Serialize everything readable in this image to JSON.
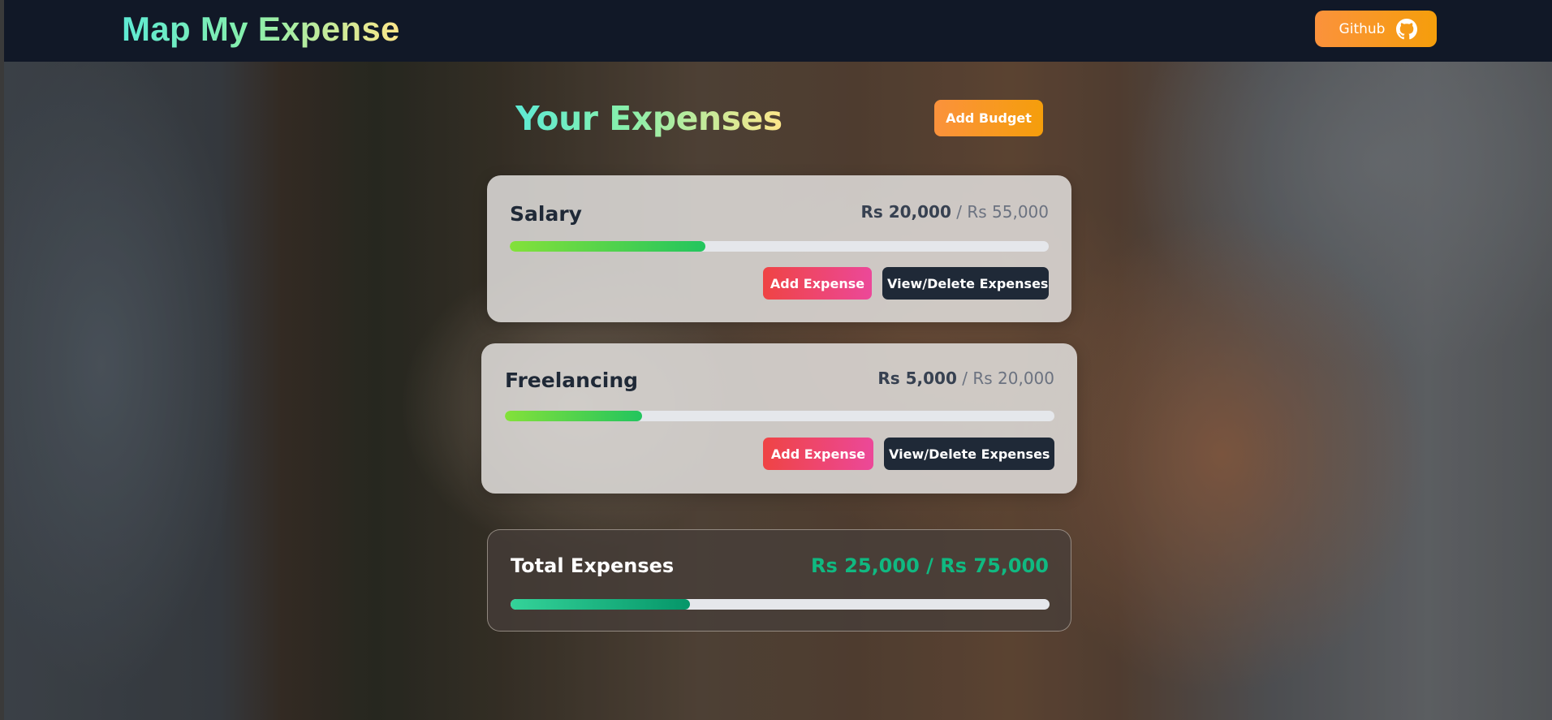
{
  "header": {
    "brand": "Map My Expense",
    "github_label": "Github"
  },
  "main": {
    "title": "Your Expenses",
    "add_budget_label": "Add Budget"
  },
  "budgets": [
    {
      "name": "Salary",
      "spent": "Rs 20,000",
      "max": "/ Rs 55,000",
      "progress": 0.3636,
      "add_expense_label": "Add Expense",
      "view_delete_label": "View/Delete Expenses"
    },
    {
      "name": "Freelancing",
      "spent": "Rs 5,000",
      "max": "/ Rs 20,000",
      "progress": 0.25,
      "add_expense_label": "Add Expense",
      "view_delete_label": "View/Delete Expenses"
    }
  ],
  "total": {
    "label": "Total Expenses",
    "amount": "Rs 25,000 / Rs 75,000",
    "progress": 0.3333
  },
  "colors": {
    "navbar": "#111827",
    "accent_orange": "#fb923c",
    "add_expense_start": "#ef4444",
    "add_expense_end": "#ec4899",
    "view_button": "#1f2937",
    "total_amount": "#10b981",
    "progress_green": "#22c55e"
  },
  "icons": {
    "github": "github-icon"
  }
}
